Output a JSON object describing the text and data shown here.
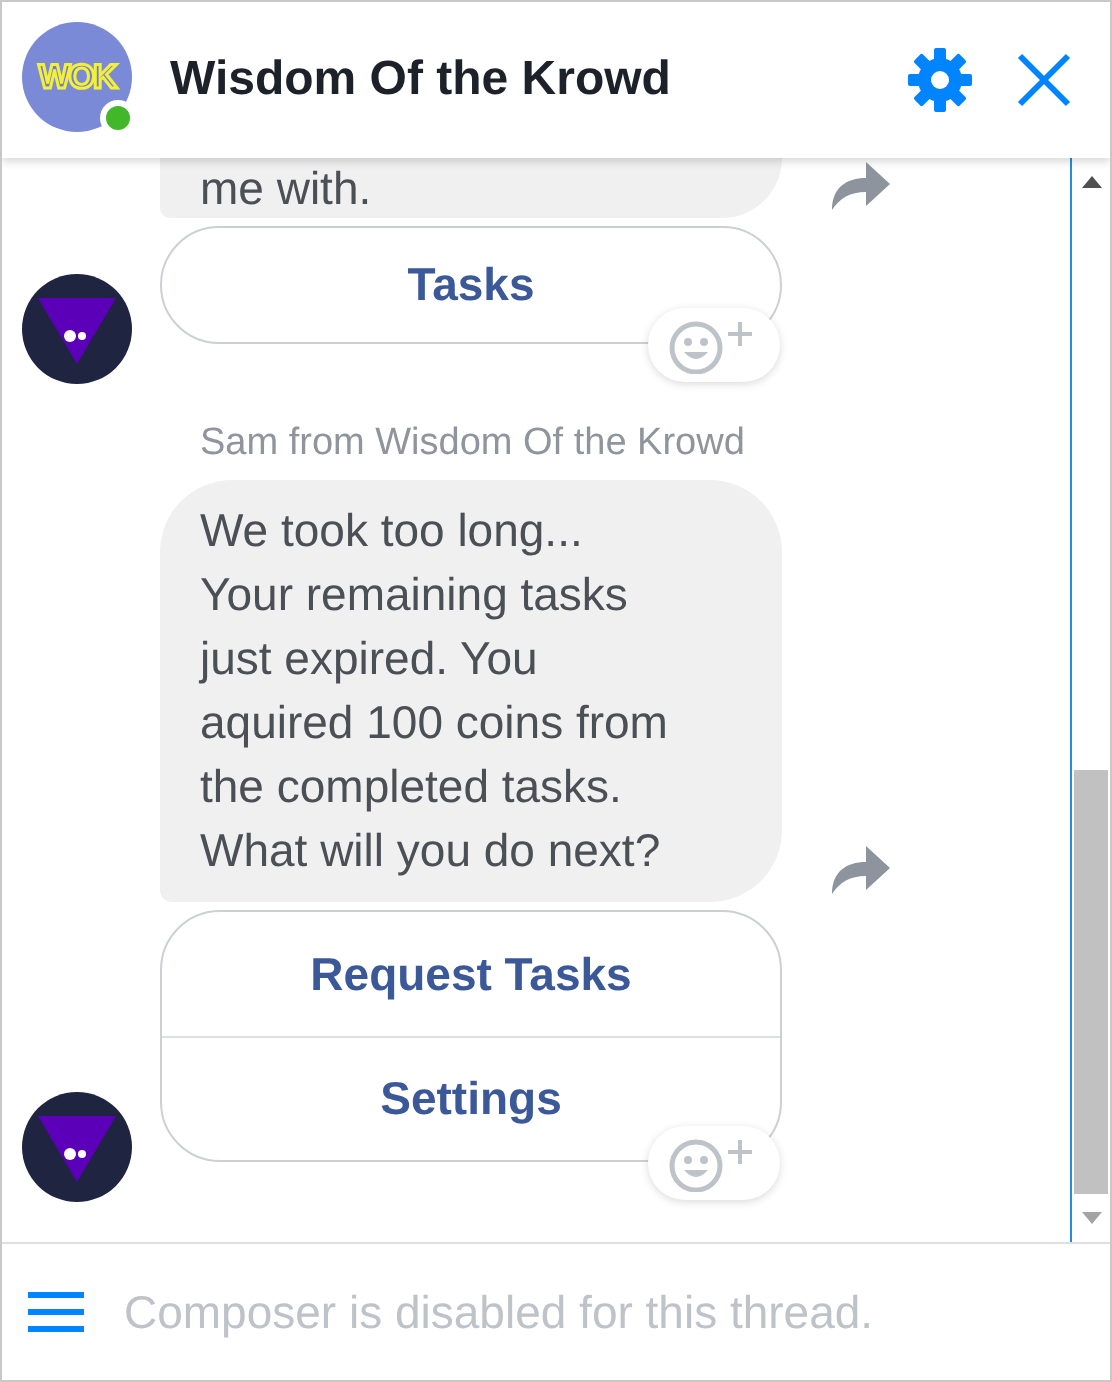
{
  "header": {
    "title": "Wisdom Of the Krowd",
    "logo_text": "WOK",
    "online": true
  },
  "messages": [
    {
      "text": "me with.",
      "reply_options": [
        "Tasks"
      ]
    },
    {
      "sender": "Sam from Wisdom Of the Krowd",
      "text": "We took too long...\nYour remaining tasks\njust expired. You\naquired 100 coins from\nthe completed tasks.\nWhat will you do next?",
      "reply_options": [
        "Request Tasks",
        "Settings"
      ]
    }
  ],
  "composer": {
    "placeholder": "Composer is disabled for this thread."
  }
}
